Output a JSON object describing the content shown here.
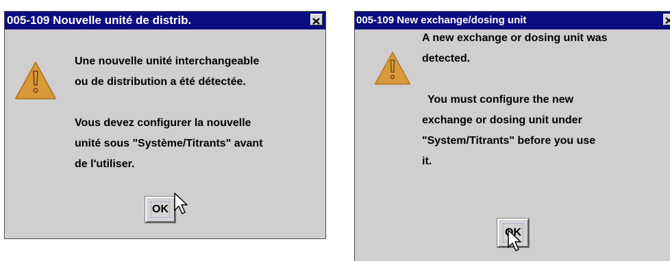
{
  "dialogs": [
    {
      "title": "005-109 Nouvelle unité de distrib.",
      "icon": "warning-icon",
      "message": {
        "p1": [
          "Une nouvelle unité interchangeable",
          "ou de distribution a été détectée."
        ],
        "p2": [
          "Vous devez configurer la nouvelle",
          "unité sous \"Système/Titrants\" avant",
          "de l'utiliser."
        ]
      },
      "ok_label": "OK"
    },
    {
      "title": "005-109 New exchange/dosing unit",
      "icon": "warning-icon",
      "message": {
        "p1": [
          "A new exchange or dosing unit was",
          "detected."
        ],
        "p2": [
          "You must configure the new",
          "exchange or dosing unit under",
          "\"System/Titrants\" before you use",
          "it."
        ]
      },
      "ok_label": "OK"
    }
  ],
  "colors": {
    "titlebar": "#0b0d80",
    "dialog_bg": "#cfcfcf",
    "warning_fill": "#d99a3c"
  }
}
